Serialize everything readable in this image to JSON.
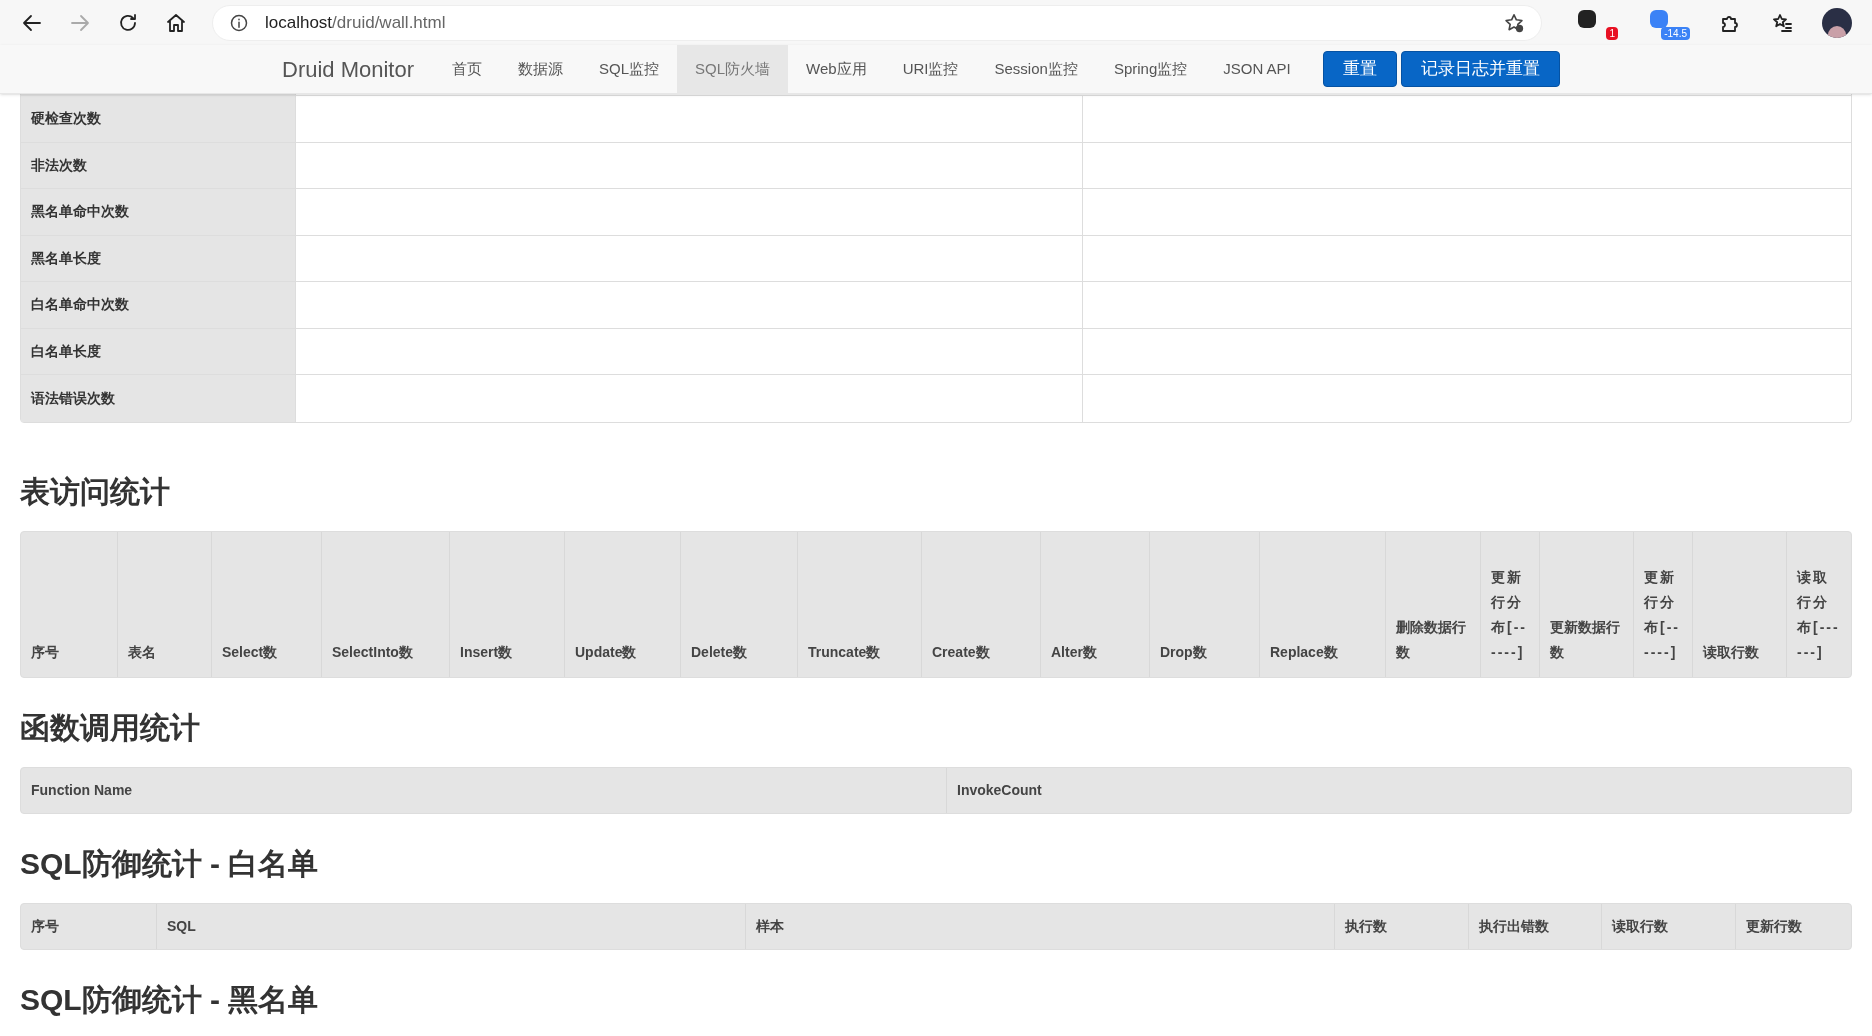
{
  "browser": {
    "url_host": "localhost",
    "url_path": "/druid/wall.html",
    "back_disabled": false,
    "forward_disabled": true,
    "extensions": [
      {
        "badge": "1",
        "color": "#e81123"
      },
      {
        "badge": "-14.5",
        "color": "#3b82f6"
      }
    ]
  },
  "navbar": {
    "brand": "Druid Monitor",
    "items": [
      {
        "label": "首页",
        "selected": false
      },
      {
        "label": "数据源",
        "selected": false
      },
      {
        "label": "SQL监控",
        "selected": false
      },
      {
        "label": "SQL防火墙",
        "selected": true
      },
      {
        "label": "Web应用",
        "selected": false
      },
      {
        "label": "URI监控",
        "selected": false
      },
      {
        "label": "Session监控",
        "selected": false
      },
      {
        "label": "Spring监控",
        "selected": false
      },
      {
        "label": "JSON API",
        "selected": false
      }
    ],
    "buttons": [
      "重置",
      "记录日志并重置"
    ]
  },
  "stats_table": {
    "rows": [
      "硬检查次数",
      "非法次数",
      "黑名单命中次数",
      "黑名单长度",
      "白名单命中次数",
      "白名单长度",
      "语法错误次数"
    ]
  },
  "sections": [
    {
      "title": "表访问统计",
      "columns": [
        "序号",
        "表名",
        "Select数",
        "SelectInto数",
        "Insert数",
        "Update数",
        "Delete数",
        "Truncate数",
        "Create数",
        "Alter数",
        "Drop数",
        "Replace数",
        "删除数据行数",
        "更新行分布[------]",
        "更新数据行数",
        "更新行分布[------]",
        "读取行数",
        "读取行分布[------]"
      ]
    },
    {
      "title": "函数调用统计",
      "columns": [
        "Function Name",
        "InvokeCount"
      ]
    },
    {
      "title": "SQL防御统计 - 白名单",
      "columns": [
        "序号",
        "SQL",
        "样本",
        "执行数",
        "执行出错数",
        "读取行数",
        "更新行数"
      ]
    },
    {
      "title": "SQL防御统计 - 黑名单"
    }
  ]
}
